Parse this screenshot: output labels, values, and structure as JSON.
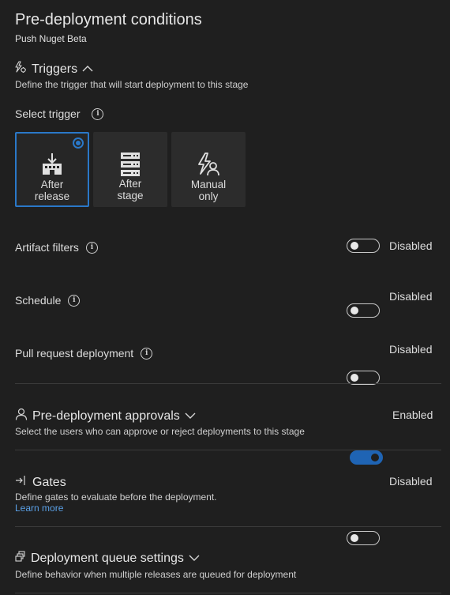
{
  "header": {
    "title": "Pre-deployment conditions",
    "subtitle": "Push Nuget Beta"
  },
  "triggers": {
    "heading": "Triggers",
    "description": "Define the trigger that will start deployment to this stage",
    "select_label": "Select trigger",
    "options": [
      {
        "line1": "After",
        "line2": "release",
        "selected": true
      },
      {
        "line1": "After",
        "line2": "stage",
        "selected": false
      },
      {
        "line1": "Manual",
        "line2": "only",
        "selected": false
      }
    ]
  },
  "settings": [
    {
      "label": "Artifact filters",
      "state": "Disabled"
    },
    {
      "label": "Schedule",
      "state": "Disabled"
    },
    {
      "label": "Pull request deployment",
      "state": "Disabled"
    }
  ],
  "approvals": {
    "heading": "Pre-deployment approvals",
    "description": "Select the users who can approve or reject deployments to this stage",
    "state": "Enabled"
  },
  "gates": {
    "heading": "Gates",
    "description": "Define gates to evaluate before the deployment.",
    "link": "Learn more",
    "state": "Disabled"
  },
  "queue": {
    "heading": "Deployment queue settings",
    "description": "Define behavior when multiple releases are queued for deployment"
  },
  "colors": {
    "background": "#1f1f1f",
    "accent": "#2a78c8",
    "link": "#5aa0e6"
  }
}
